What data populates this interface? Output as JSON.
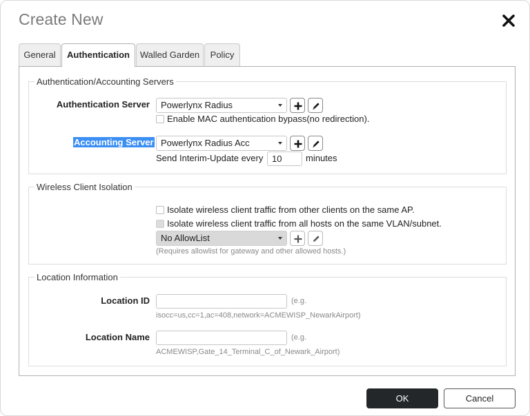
{
  "dialog": {
    "title": "Create New",
    "tabs": [
      {
        "label": "General",
        "active": false
      },
      {
        "label": "Authentication",
        "active": true
      },
      {
        "label": "Walled Garden",
        "active": false
      },
      {
        "label": "Policy",
        "active": false
      }
    ]
  },
  "auth_servers": {
    "legend": "Authentication/Accounting Servers",
    "auth_server_label": "Authentication Server",
    "auth_server_value": "Powerlynx Radius",
    "mac_bypass_label": "Enable MAC authentication bypass(no redirection).",
    "acct_server_label": "Accounting Server",
    "acct_server_value": "Powerlynx Radius Acc",
    "interim_prefix": "Send Interim-Update every",
    "interim_value": "10",
    "interim_suffix": "minutes"
  },
  "isolation": {
    "legend": "Wireless Client Isolation",
    "isolate_ap_label": "Isolate wireless client traffic from other clients on the same AP.",
    "isolate_vlan_label": "Isolate wireless client traffic from all hosts on the same VLAN/subnet.",
    "allowlist_value": "No AllowList",
    "allowlist_hint": "(Requires allowlist for gateway and other allowed hosts.)"
  },
  "location": {
    "legend": "Location Information",
    "location_id_label": "Location ID",
    "location_id_value": "",
    "location_id_eg": "(e.g.",
    "location_id_example": "isocc=us,cc=1,ac=408,network=ACMEWISP_NewarkAirport)",
    "location_name_label": "Location Name",
    "location_name_value": "",
    "location_name_eg": "(e.g.",
    "location_name_example": "ACMEWISP,Gate_14_Terminal_C_of_Newark_Airport)"
  },
  "footer": {
    "ok_label": "OK",
    "cancel_label": "Cancel"
  },
  "icons": {
    "close": "close-icon",
    "add": "plus-icon",
    "edit": "pencil-icon"
  }
}
